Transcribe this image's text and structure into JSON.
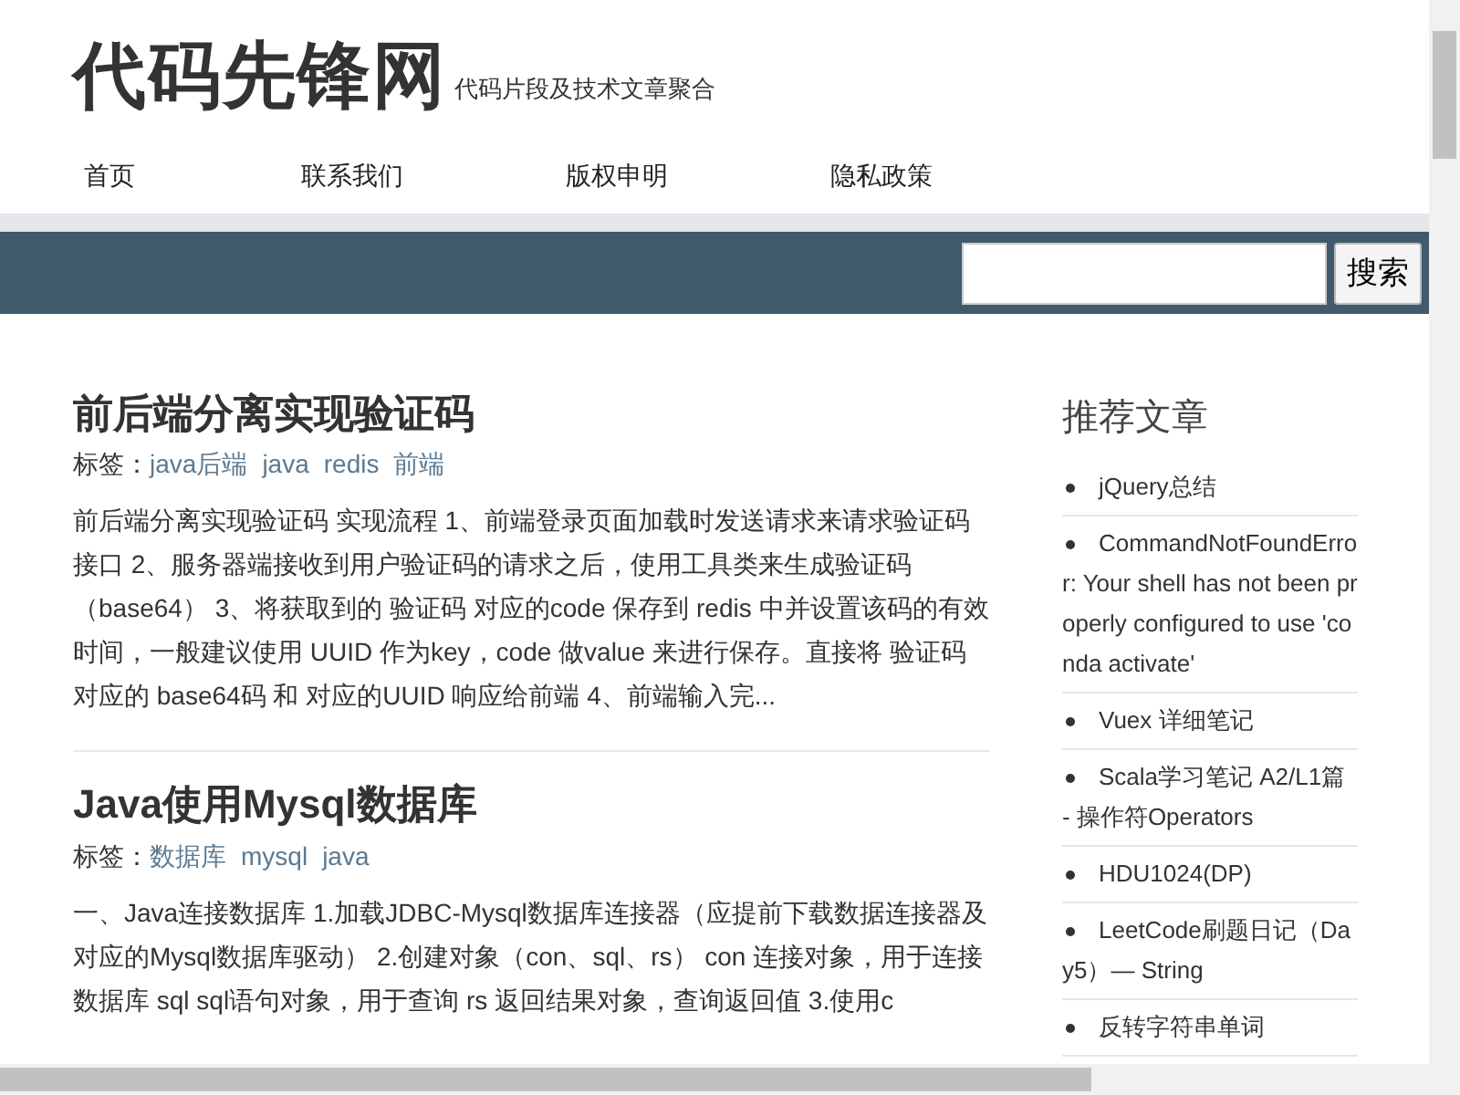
{
  "site": {
    "title": "代码先锋网",
    "tagline": "代码片段及技术文章聚合"
  },
  "nav": [
    "首页",
    "联系我们",
    "版权申明",
    "隐私政策"
  ],
  "search": {
    "button": "搜索"
  },
  "articles": [
    {
      "title": "前后端分离实现验证码",
      "tags_label": "标签：",
      "tags": [
        "java后端",
        "java",
        "redis",
        "前端"
      ],
      "summary": "前后端分离实现验证码 实现流程 1、前端登录页面加载时发送请求来请求验证码接口 2、服务器端接收到用户验证码的请求之后，使用工具类来生成验证码（base64） 3、将获取到的 验证码 对应的code 保存到 redis 中并设置该码的有效时间，一般建议使用 UUID 作为key，code 做value 来进行保存。直接将 验证码对应的 base64码 和 对应的UUID 响应给前端 4、前端输入完..."
    },
    {
      "title": "Java使用Mysql数据库",
      "tags_label": "标签：",
      "tags": [
        "数据库",
        "mysql",
        "java"
      ],
      "summary": "一、Java连接数据库 1.加载JDBC-Mysql数据库连接器（应提前下载数据连接器及对应的Mysql数据库驱动） 2.创建对象（con、sql、rs） con 连接对象，用于连接数据库 sql  sql语句对象，用于查询 rs 返回结果对象，查询返回值 3.使用c"
    }
  ],
  "sidebar": {
    "title": "推荐文章",
    "items": [
      "jQuery总结",
      "CommandNotFoundError: Your shell has not been properly configured to use 'conda activate'",
      "Vuex 详细笔记",
      "Scala学习笔记 A2/L1篇 - 操作符Operators",
      "HDU1024(DP)",
      "LeetCode刷题日记（Day5）— String",
      "反转字符串单词"
    ]
  }
}
